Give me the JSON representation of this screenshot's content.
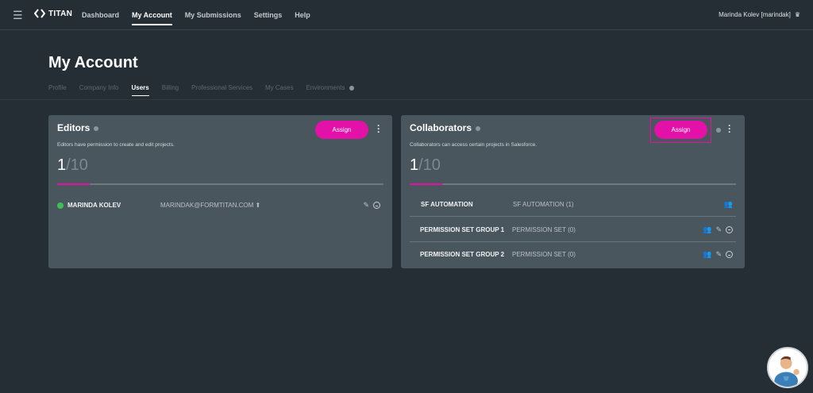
{
  "header": {
    "brand": "TITAN",
    "nav": [
      "Dashboard",
      "My Account",
      "My Submissions",
      "Settings",
      "Help"
    ],
    "active_nav": "My Account",
    "user": "Marinda Kolev [marindak]"
  },
  "page": {
    "title": "My Account",
    "tabs": [
      "Profile",
      "Company Info",
      "Users",
      "Billing",
      "Professional Services",
      "My Cases",
      "Environments"
    ],
    "active_tab": "Users"
  },
  "editors": {
    "title": "Editors",
    "assign_label": "Assign",
    "description": "Editors have permission to create and edit projects.",
    "used": "1",
    "max": "/10",
    "progress": 0.1,
    "users": [
      {
        "name": "MARINDA KOLEV",
        "email": "MARINDAK@FORMTITAN.COM",
        "status": "active"
      }
    ]
  },
  "collaborators": {
    "title": "Collaborators",
    "assign_label": "Assign",
    "description": "Collaborators can access certain projects in Salesforce.",
    "used": "1",
    "max": "/10",
    "progress": 0.1,
    "rows": [
      {
        "name": "SF AUTOMATION",
        "type": "SF AUTOMATION (1)"
      },
      {
        "name": "PERMISSION SET GROUP 1",
        "type": "PERMISSION SET (0)"
      },
      {
        "name": "PERMISSION SET GROUP 2",
        "type": "PERMISSION SET (0)"
      }
    ]
  },
  "colors": {
    "accent": "#e311a8",
    "background": "#252e35",
    "card": "#4a565d"
  }
}
